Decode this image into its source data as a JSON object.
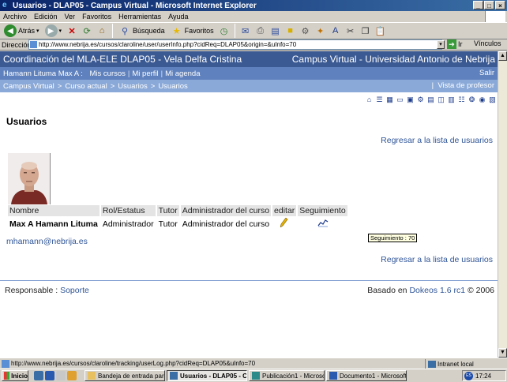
{
  "window": {
    "title": "Usuarios - DLAP05 - Campus Virtual - Microsoft Internet Explorer",
    "buttons": [
      "_",
      "□",
      "×"
    ]
  },
  "menu": [
    "Archivo",
    "Edición",
    "Ver",
    "Favoritos",
    "Herramientas",
    "Ayuda"
  ],
  "toolbar": {
    "back_label": "Atrás",
    "search_label": "Búsqueda",
    "favorites_label": "Favoritos"
  },
  "address": {
    "label": "Dirección",
    "url": "http://www.nebrija.es/cursos/claroline/user/userInfo.php?cidReq=DLAP05&origin=&uInfo=70",
    "go_label": "Ir",
    "links_label": "Vínculos"
  },
  "site": {
    "course_title": "Coordinación del MLA-ELE DLAP05 - Vela Delfa Cristina",
    "campus_title": "Campus Virtual - Universidad Antonio de Nebrija",
    "user_label": "Hamann Lituma Max A :",
    "user_links": [
      "Mis cursos",
      "Mi perfil",
      "Mi agenda"
    ],
    "logout": "Salir",
    "breadcrumb": [
      "Campus Virtual",
      "Curso actual",
      "Usuarios",
      "Usuarios"
    ],
    "teacher_view": "Vista de profesor"
  },
  "colors": {
    "header_dark": "#3b5a93",
    "header_mid": "#5f81bd",
    "header_light": "#8aa9d8",
    "link": "#2f5597"
  },
  "page": {
    "title": "Usuarios",
    "back_link": "Regresar a la lista de usuarios",
    "table": {
      "headers": [
        "Nombre",
        "Rol/Estatus",
        "Tutor",
        "Administrador del curso",
        "editar",
        "Seguimiento"
      ],
      "row": {
        "name": "Max A Hamann Lituma",
        "role": "Administrador",
        "tutor": "Tutor",
        "admin": "Administrador del curso",
        "edit_icon": "pencil-icon",
        "tracking_icon": "chart-icon"
      }
    },
    "email": "mhamann@nebrija.es",
    "tooltip": "Seguimiento : 70"
  },
  "footer": {
    "responsible_label": "Responsable :",
    "responsible_link": "Soporte",
    "based_on": "Basado en",
    "platform": "Dokeos 1.6 rc1",
    "copyright": "© 2006"
  },
  "status": {
    "text": "http://www.nebrija.es/cursos/claroline/tracking/userLog.php?cidReq=DLAP05&uInfo=70",
    "zone": "Intranet local"
  },
  "taskbar": {
    "start": "Inicio",
    "tasks": [
      "Bandeja de entrada para ...",
      "Usuarios - DLAP05 - C...",
      "Publicación1 - Microsoft ...",
      "Documento1 - Microsoft ..."
    ],
    "clock": "17:24"
  }
}
